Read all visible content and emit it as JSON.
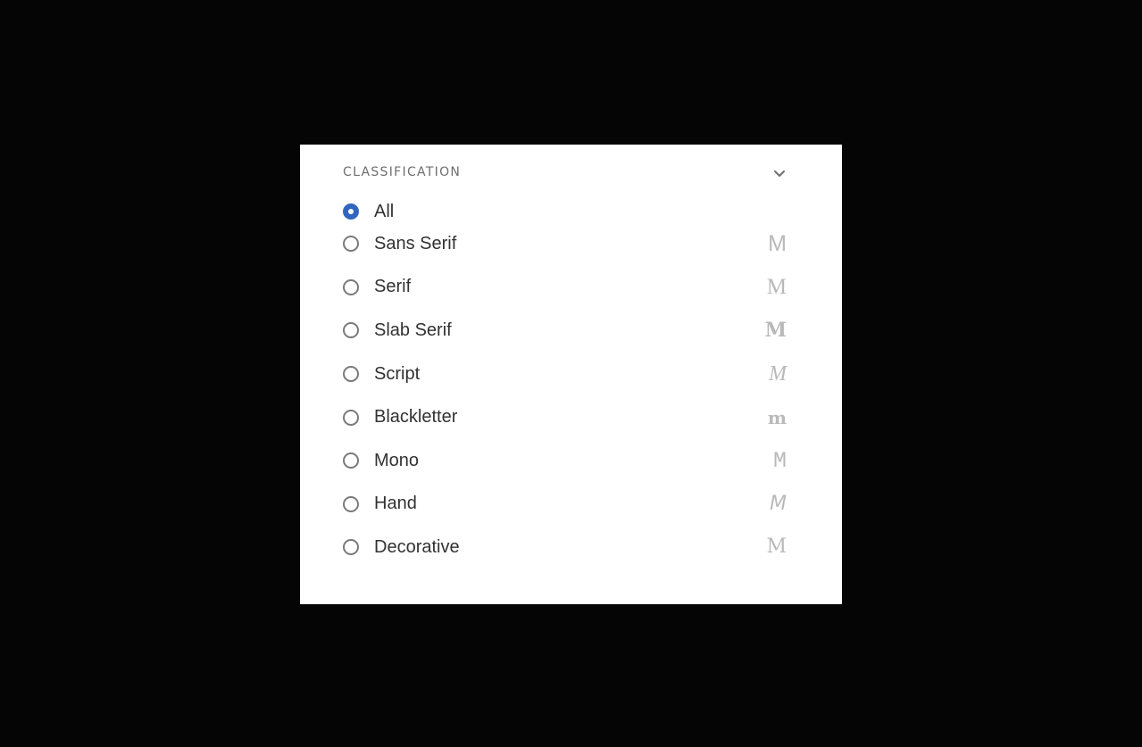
{
  "panel": {
    "title": "CLASSIFICATION",
    "options": [
      {
        "label": "All",
        "sample": "",
        "checked": true
      },
      {
        "label": "Sans Serif",
        "sample": "M",
        "checked": false
      },
      {
        "label": "Serif",
        "sample": "M",
        "checked": false
      },
      {
        "label": "Slab Serif",
        "sample": "M",
        "checked": false
      },
      {
        "label": "Script",
        "sample": "M",
        "checked": false
      },
      {
        "label": "Blackletter",
        "sample": "m",
        "checked": false
      },
      {
        "label": "Mono",
        "sample": "M",
        "checked": false
      },
      {
        "label": "Hand",
        "sample": "M",
        "checked": false
      },
      {
        "label": "Decorative",
        "sample": "M",
        "checked": false
      }
    ]
  },
  "colors": {
    "accent": "#3265c0",
    "background": "#050505",
    "panel": "#ffffff"
  },
  "icons": {
    "collapse": "chevron-down-icon"
  }
}
